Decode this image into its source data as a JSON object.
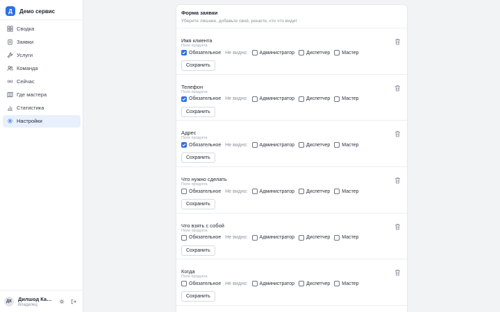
{
  "app": {
    "logo_letter": "Д",
    "name": "Демо сервис"
  },
  "nav": [
    {
      "label": "Сводка",
      "icon": "dashboard-icon",
      "active": false
    },
    {
      "label": "Заявки",
      "icon": "clipboard-icon",
      "active": false
    },
    {
      "label": "Услуги",
      "icon": "wrench-icon",
      "active": false
    },
    {
      "label": "Команда",
      "icon": "users-icon",
      "active": false
    },
    {
      "label": "Сейчас",
      "icon": "live-icon",
      "active": false
    },
    {
      "label": "Где мастера",
      "icon": "map-icon",
      "active": false
    },
    {
      "label": "Статистика",
      "icon": "chart-icon",
      "active": false
    },
    {
      "label": "Настройки",
      "icon": "gear-icon",
      "active": true
    }
  ],
  "user": {
    "initials": "ДК",
    "name": "Дилшод Кар…",
    "role": "Владелец"
  },
  "form": {
    "title": "Форма заявки",
    "subtitle": "Уберите лишнее, добавьте своё, решите, кто что видит",
    "labels": {
      "required": "Обязательное",
      "hidden_for": "Не видно:",
      "admin": "Администратор",
      "dispatcher": "Диспетчер",
      "master": "Мастер",
      "save": "Сохранить"
    },
    "fields": [
      {
        "name": "Имя клиента",
        "type": "Поле продукта",
        "required": true,
        "admin": false,
        "dispatcher": false,
        "master": false
      },
      {
        "name": "Телефон",
        "type": "Поле продукта",
        "required": true,
        "admin": false,
        "dispatcher": false,
        "master": false
      },
      {
        "name": "Адрес",
        "type": "Поле продукта",
        "required": true,
        "admin": false,
        "dispatcher": false,
        "master": false
      },
      {
        "name": "Что нужно сделать",
        "type": "Поле продукта",
        "required": false,
        "admin": false,
        "dispatcher": false,
        "master": false
      },
      {
        "name": "Что взять с собой",
        "type": "Поле продукта",
        "required": false,
        "admin": false,
        "dispatcher": false,
        "master": false
      },
      {
        "name": "Когда",
        "type": "Поле продукта",
        "required": false,
        "admin": false,
        "dispatcher": false,
        "master": false
      }
    ]
  },
  "colors": {
    "accent": "#2f6fe4",
    "active_nav_bg": "#e8f0fd"
  }
}
